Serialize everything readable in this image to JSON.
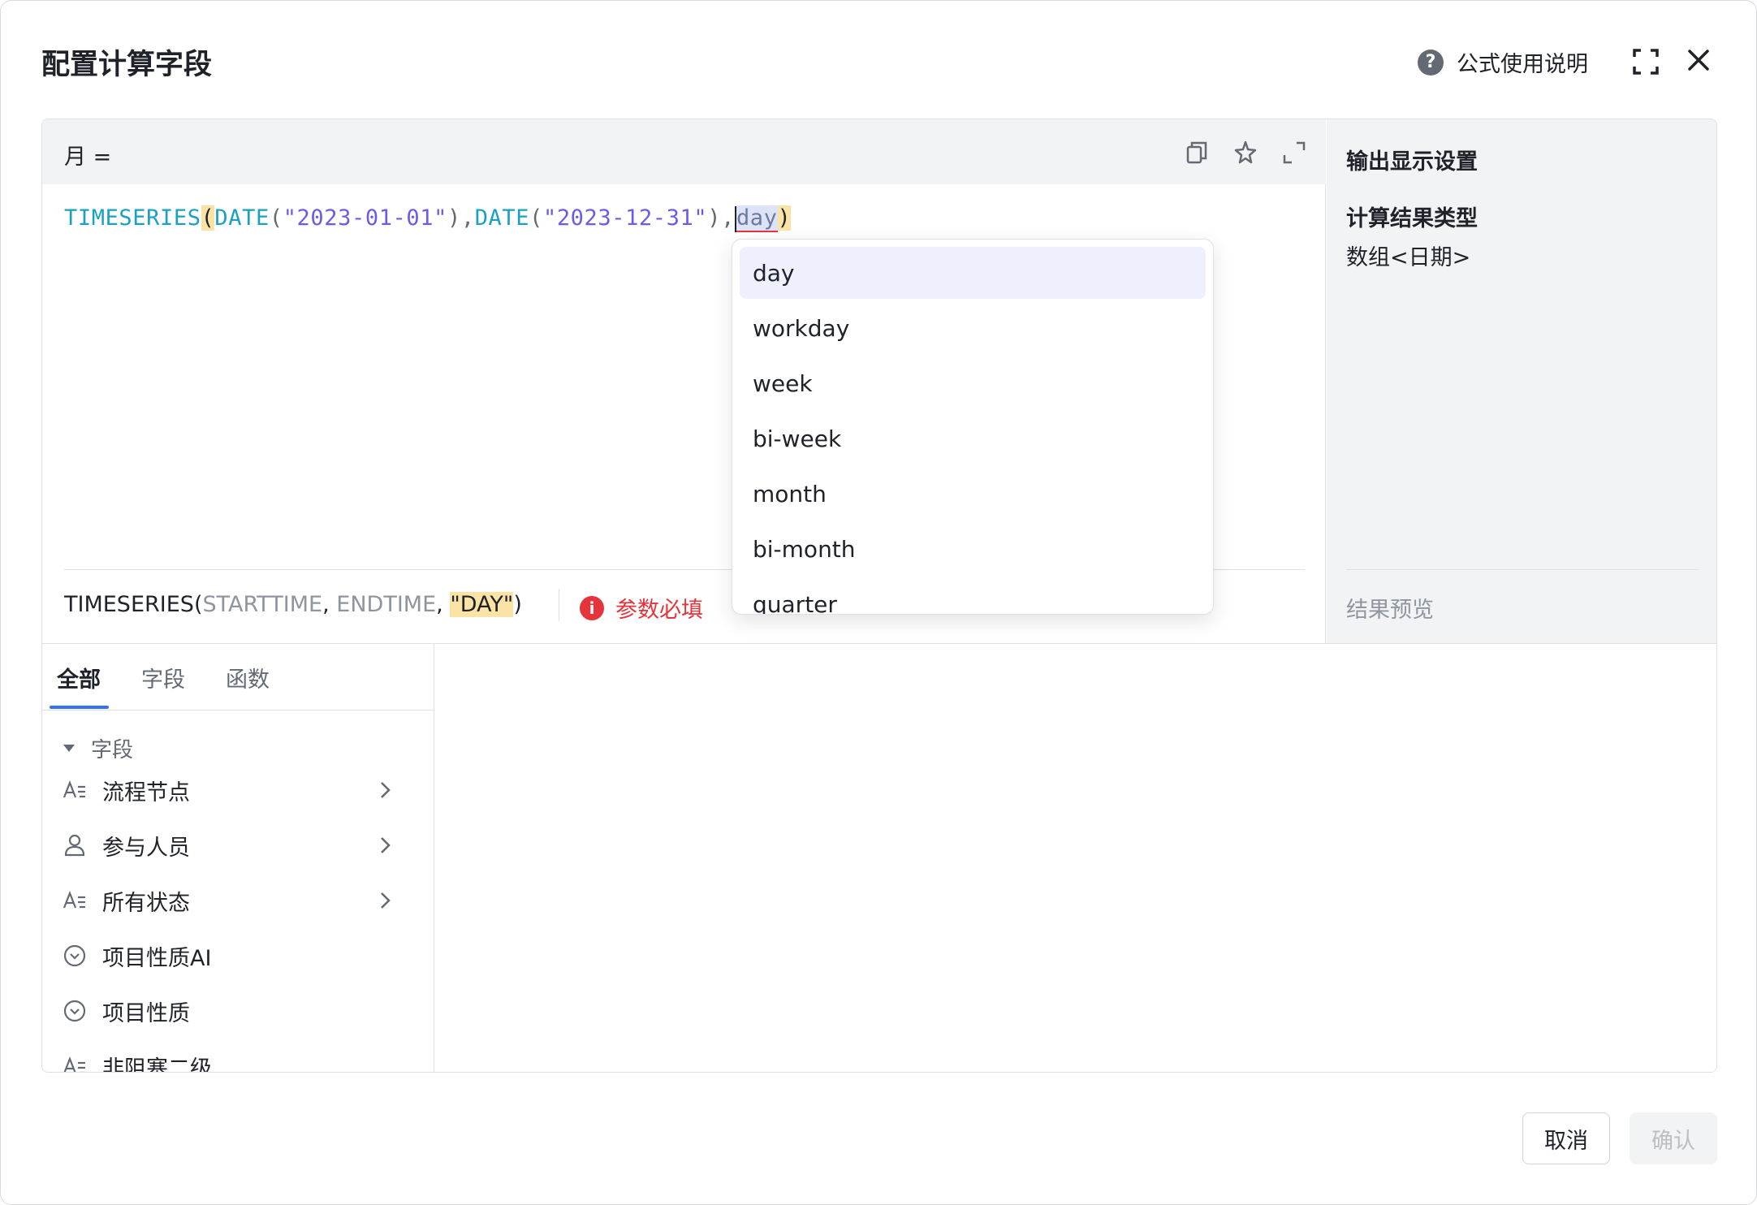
{
  "dialog": {
    "title": "配置计算字段",
    "help_label": "公式使用说明"
  },
  "editor": {
    "field_name": "月 =",
    "code": {
      "fn1": "TIMESERIES",
      "open": "(",
      "fn2": "DATE",
      "p2o": "(",
      "str1": "\"2023-01-01\"",
      "p2c": ")",
      "comma1": ",",
      "fn3": "DATE",
      "p3o": "(",
      "str2": "\"2023-12-31\"",
      "p3c": ")",
      "comma2": ",",
      "arg": "day",
      "close": ")"
    },
    "signature": {
      "fn": "TIMESERIES",
      "open": "(",
      "p1": "STARTTIME",
      "sep1": ", ",
      "p2": "ENDTIME",
      "sep2": ", ",
      "p3": "\"DAY\"",
      "close": ")"
    },
    "error_text": "参数必填"
  },
  "suggestions": [
    "day",
    "workday",
    "week",
    "bi-week",
    "month",
    "bi-month",
    "quarter"
  ],
  "output": {
    "title": "输出显示设置",
    "result_type_label": "计算结果类型",
    "result_type_value": "数组<日期>",
    "preview_label": "结果预览"
  },
  "browser": {
    "tabs": [
      "全部",
      "字段",
      "函数"
    ],
    "group_label": "字段",
    "items": [
      {
        "label": "流程节点",
        "icon": "text-field-icon",
        "expandable": true
      },
      {
        "label": "参与人员",
        "icon": "person-icon",
        "expandable": true
      },
      {
        "label": "所有状态",
        "icon": "text-field-icon",
        "expandable": true
      },
      {
        "label": "项目性质AI",
        "icon": "select-field-icon",
        "expandable": false
      },
      {
        "label": "项目性质",
        "icon": "select-field-icon",
        "expandable": false
      },
      {
        "label": "非阻塞二级",
        "icon": "text-field-icon",
        "expandable": false
      }
    ]
  },
  "footer": {
    "cancel": "取消",
    "confirm": "确认"
  },
  "colors": {
    "accent": "#3370ff",
    "error": "#e6343b",
    "function": "#1aa1c2",
    "string": "#6b5ce7",
    "highlight": "#fbe3a5"
  }
}
